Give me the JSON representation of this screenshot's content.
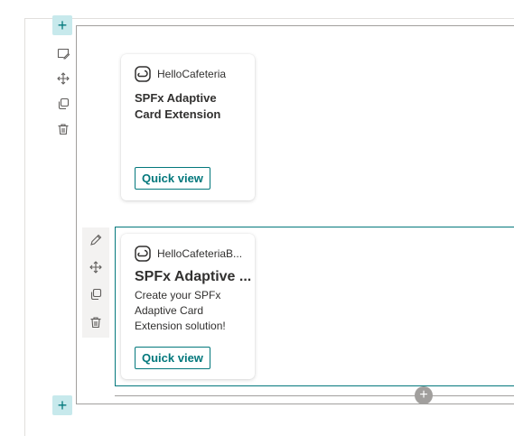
{
  "toolbar": {
    "add_section_top": "+",
    "add_section_bottom": "+",
    "add_webpart": "+"
  },
  "cards": [
    {
      "app_name": "HelloCafeteria",
      "title": "SPFx Adaptive Card Extension",
      "description": "",
      "button_label": "Quick view"
    },
    {
      "app_name": "HelloCafeteriaB...",
      "title": "SPFx Adaptive ...",
      "description": "Create your SPFx Adaptive Card Extension solution!",
      "button_label": "Quick view"
    }
  ],
  "colors": {
    "accent": "#03787c",
    "accent_light": "#c7e9ec",
    "border": "#a19f9d"
  },
  "icons": {
    "section_toolbar": [
      "edit-section-icon",
      "move-icon",
      "duplicate-icon",
      "delete-icon"
    ],
    "webpart_toolbar": [
      "edit-icon",
      "move-icon",
      "duplicate-icon",
      "delete-icon"
    ],
    "card_logo": "adaptive-card-logo-icon"
  }
}
